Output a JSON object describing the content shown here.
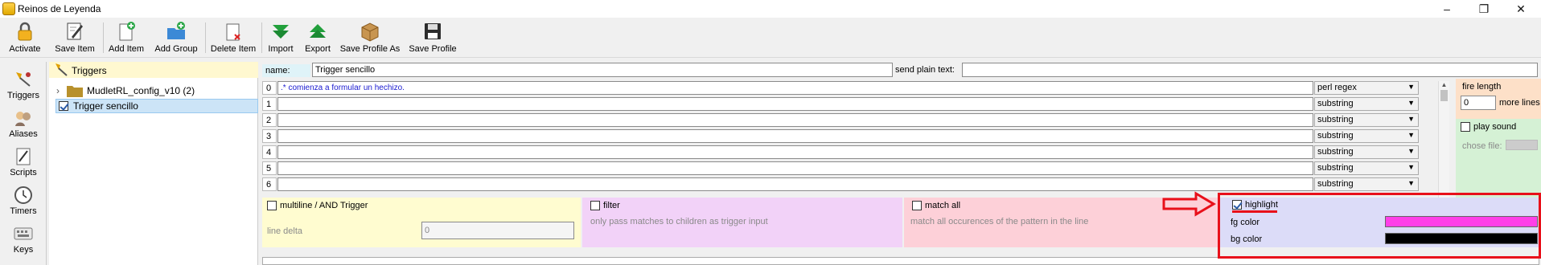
{
  "window": {
    "title": "Reinos de Leyenda"
  },
  "toolbar": {
    "activate": "Activate",
    "save_item": "Save Item",
    "add_item": "Add Item",
    "add_group": "Add Group",
    "delete_item": "Delete Item",
    "import": "Import",
    "export": "Export",
    "save_profile_as": "Save Profile As",
    "save_profile": "Save Profile"
  },
  "sidebar": {
    "items": [
      "Triggers",
      "Aliases",
      "Scripts",
      "Timers",
      "Keys"
    ]
  },
  "tree": {
    "header": "Triggers",
    "folder": "MudletRL_config_v10 (2)",
    "selected": "Trigger sencillo"
  },
  "editor": {
    "name_label": "name:",
    "name_value": "Trigger sencillo",
    "send_label": "send plain text:",
    "send_value": "",
    "patterns": [
      {
        "num": "0",
        "text": ".* comienza a formular un hechizo.",
        "type": "perl regex"
      },
      {
        "num": "1",
        "text": "",
        "type": "substring"
      },
      {
        "num": "2",
        "text": "",
        "type": "substring"
      },
      {
        "num": "3",
        "text": "",
        "type": "substring"
      },
      {
        "num": "4",
        "text": "",
        "type": "substring"
      },
      {
        "num": "5",
        "text": "",
        "type": "substring"
      },
      {
        "num": "6",
        "text": "",
        "type": "substring"
      }
    ],
    "fire_length_label": "fire length",
    "fire_length_value": "0",
    "more_lines_label": "more lines",
    "play_sound_label": "play sound",
    "chose_file_label": "chose file:",
    "multiline_label": "multiline / AND Trigger",
    "line_delta_label": "line delta",
    "line_delta_value": "0",
    "filter_label": "filter",
    "filter_desc": "only pass matches to children as trigger input",
    "match_all_label": "match all",
    "match_all_desc": "match all occurences of the pattern in the line",
    "highlight_label": "highlight",
    "fg_color_label": "fg color",
    "bg_color_label": "bg color"
  },
  "colors": {
    "fg_color": "#ff40e8",
    "bg_color": "#000000",
    "annotation": "#e8101a"
  },
  "icons": {
    "activate": "lock-icon",
    "save_item": "pen-paper-icon",
    "add_item": "add-document-icon",
    "add_group": "add-folder-icon",
    "delete_item": "delete-document-icon",
    "import": "down-arrow-icon",
    "export": "up-arrow-icon",
    "save_profile_as": "box-icon",
    "save_profile": "floppy-disk-icon"
  }
}
